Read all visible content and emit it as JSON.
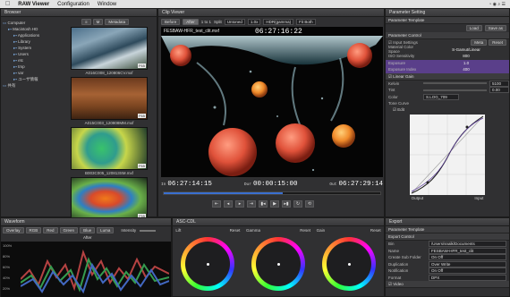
{
  "menubar": {
    "app": "RAW Viewer",
    "items": [
      "Configuration",
      "Window"
    ]
  },
  "browser": {
    "title": "Browser",
    "tree": [
      {
        "label": "Computer",
        "level": 0
      },
      {
        "label": "Macintosh HD",
        "level": 1
      },
      {
        "label": "Applications",
        "level": 2
      },
      {
        "label": "Library",
        "level": 2
      },
      {
        "label": "System",
        "level": 2
      },
      {
        "label": "Users",
        "level": 2
      },
      {
        "label": "etc",
        "level": 2
      },
      {
        "label": "tmp",
        "level": 2
      },
      {
        "label": "var",
        "level": 2
      },
      {
        "label": "ユーザ情報",
        "level": 2
      },
      {
        "label": "共有",
        "level": 0
      }
    ],
    "tabs": [
      "≡",
      "M",
      "Metadata"
    ],
    "thumbs": [
      {
        "name": "A016C008_120806CV.mxf",
        "badge": "F65"
      },
      {
        "name": "A015C003_120808MM.mxf",
        "badge": "F65"
      },
      {
        "name": "B003C005_120813SM.mxf",
        "badge": "F65"
      },
      {
        "name": "A001C001_120815KL.mxf",
        "badge": "F55"
      }
    ]
  },
  "clipviewer": {
    "title": "Clip Viewer",
    "tabs": [
      "Before",
      "After",
      "1 to 1",
      "Split"
    ],
    "dropdowns": [
      "Untoned",
      "1.0x",
      "HDR(gamma)",
      "Fit Both"
    ],
    "filename": "FESBAW-HFR_test_clit.mxf",
    "timecode": "06:27:16:22",
    "in_label": "In",
    "in_tc": "06:27:14:15",
    "dur_label": "Dur",
    "dur_tc": "00:00:15:00",
    "out_label": "Out",
    "out_tc": "06:27:29:14",
    "controls": [
      "⇤",
      "◂",
      "▸",
      "⇥",
      "▮◂",
      "▶",
      "▸▮",
      "↻",
      "⟲"
    ],
    "progress": 0.55
  },
  "params": {
    "title": "Parameter Setting",
    "template_label": "Parameter Template",
    "load": "Load",
    "saveas": "Save as",
    "control": "Parameter Control",
    "input_settings": "Input Settings",
    "meta": "Meta",
    "reset": "Reset",
    "rows": [
      {
        "k": "Material Color Space",
        "v": "S-Gamut/Linear"
      },
      {
        "k": "ISO Sensitivity",
        "v": "800"
      },
      {
        "k": "Exposure",
        "v": "1.0"
      },
      {
        "k": "Exposure Index",
        "v": "400"
      }
    ],
    "linear_gain": "Linear Gain",
    "kelvin": "Kelvin",
    "kelvin_v": "5100",
    "tint": "Tint",
    "tint_v": "0.00",
    "color": "Color",
    "color_v": "S.LOG_709",
    "tone_curve": "Tone Curve",
    "edit": "Edit",
    "output": "Output",
    "input": "Input"
  },
  "export": {
    "title": "Export",
    "template_label": "Parameter Template",
    "control": "Export Control",
    "rows": [
      {
        "k": "Bin",
        "v": "/Users/snalk/Documents"
      },
      {
        "k": "Name",
        "v": "FESBAW-HFR_test_clit"
      },
      {
        "k": "Create Sub Folder",
        "v": "On    Off"
      },
      {
        "k": "Duplication",
        "v": "Over Write"
      },
      {
        "k": "Notification",
        "v": "On    Off"
      },
      {
        "k": "Format",
        "v": "DPX"
      }
    ],
    "video": "Video"
  },
  "waveform": {
    "title": "Waveform",
    "tabs": [
      "Overlay",
      "RGB",
      "Red",
      "Green",
      "Blue",
      "Luma"
    ],
    "intensity_label": "Intensity",
    "view": "After",
    "scale": [
      "100%",
      "80%",
      "60%",
      "40%",
      "20%"
    ]
  },
  "cdl": {
    "title": "ASC-CDL",
    "wheels": [
      {
        "label": "Lift",
        "reset": "Reset"
      },
      {
        "label": "Gamma",
        "reset": "Reset"
      },
      {
        "label": "Gain",
        "reset": "Reset"
      }
    ]
  }
}
